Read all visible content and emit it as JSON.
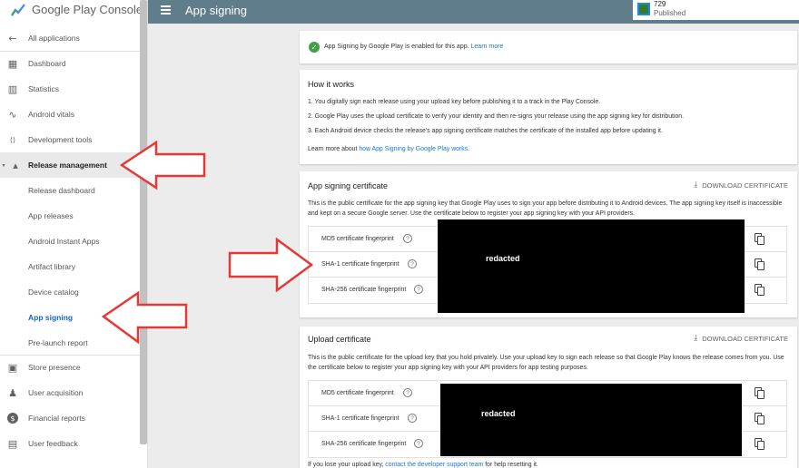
{
  "sidebar": {
    "logo_text": "Google Play Console",
    "items": [
      {
        "label": "All applications",
        "icon": "arrow-left-icon",
        "glyph": "←"
      },
      {
        "label": "Dashboard",
        "icon": "dashboard-icon",
        "glyph": "▦"
      },
      {
        "label": "Statistics",
        "icon": "bar-chart-icon",
        "glyph": "▥"
      },
      {
        "label": "Android vitals",
        "icon": "pulse-icon",
        "glyph": "∿"
      },
      {
        "label": "Development tools",
        "icon": "code-icon",
        "glyph": "⟨⟩"
      },
      {
        "label": "Release management",
        "icon": "rocket-icon",
        "glyph": "▴"
      },
      {
        "label": "Release dashboard"
      },
      {
        "label": "App releases"
      },
      {
        "label": "Android Instant Apps"
      },
      {
        "label": "Artifact library"
      },
      {
        "label": "Device catalog"
      },
      {
        "label": "App signing"
      },
      {
        "label": "Pre-launch report"
      },
      {
        "label": "Store presence",
        "icon": "store-icon",
        "glyph": "▣"
      },
      {
        "label": "User acquisition",
        "icon": "person-add-icon",
        "glyph": "♟"
      },
      {
        "label": "Financial reports",
        "icon": "dollar-icon",
        "glyph": "$"
      },
      {
        "label": "User feedback",
        "icon": "feedback-icon",
        "glyph": "▤"
      }
    ]
  },
  "topbar": {
    "title": "App signing",
    "app_number": "729",
    "app_status": "Published"
  },
  "notice": {
    "text": "App Signing by Google Play is enabled for this app.",
    "link": "Learn more"
  },
  "how_it_works": {
    "title": "How it works",
    "steps": [
      "1.   You digitally sign each release using your upload key before publishing it to a track in the Play Console.",
      "2.   Google Play uses the upload certificate to verify your identity and then re-signs your release using the app signing key for distribution.",
      "3.   Each Android device checks the release's app signing certificate matches the certificate of the installed app before updating it."
    ],
    "more_prefix": "Learn more about ",
    "more_link": "how App Signing by Google Play works."
  },
  "signing_cert": {
    "title": "App signing certificate",
    "download_label": "DOWNLOAD CERTIFICATE",
    "desc": "This is the public certificate for the app signing key that Google Play uses to sign your app before distributing it to Android devices. The app signing key itself is inaccessible and kept on a secure Google server. Use the certificate below to register your app signing key with your API providers.",
    "rows": [
      "MD5 certificate fingerprint",
      "SHA-1 certificate fingerprint",
      "SHA-256 certificate fingerprint"
    ],
    "redacted": "redacted"
  },
  "upload_cert": {
    "title": "Upload certificate",
    "download_label": "DOWNLOAD CERTIFICATE",
    "desc": "This is the public certificate for the upload key that you hold privately. Use your upload key to sign each release so that Google Play knows the release comes from you. Use the certificate below to register your app signing key with your API providers for app testing purposes.",
    "rows": [
      "MD5 certificate fingerprint",
      "SHA-1 certificate fingerprint",
      "SHA-256 certificate fingerprint"
    ],
    "redacted": "redacted"
  },
  "footer": {
    "prefix": "If you lose your upload key, ",
    "link": "contact the developer support team",
    "suffix": " for help resetting it."
  },
  "help_glyph": "?",
  "colors": {
    "topbar": "#607d8b",
    "annotation_arrow": "#e53935",
    "link": "#1976d2",
    "selected_nav": "#1565c0"
  }
}
